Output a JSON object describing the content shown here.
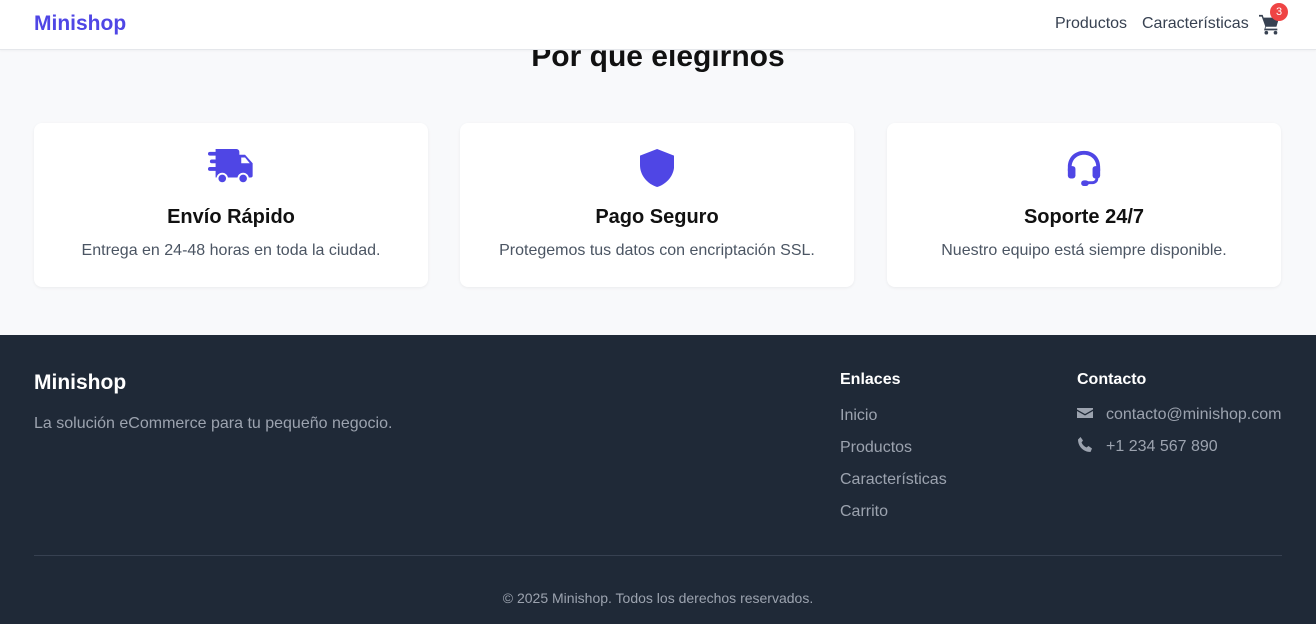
{
  "navbar": {
    "brand": "Minishop",
    "links": [
      "Productos",
      "Características"
    ],
    "cart_count": "3",
    "cart_icon": "shopping-cart-icon"
  },
  "features": {
    "title": "Por qué elegirnos",
    "cards": [
      {
        "icon": "truck-fast-icon",
        "title": "Envío Rápido",
        "description": "Entrega en 24-48 horas en toda la ciudad."
      },
      {
        "icon": "shield-icon",
        "title": "Pago Seguro",
        "description": "Protegemos tus datos con encriptación SSL."
      },
      {
        "icon": "headset-icon",
        "title": "Soporte 24/7",
        "description": "Nuestro equipo está siempre disponible."
      }
    ]
  },
  "footer": {
    "brand": "Minishop",
    "tagline": "La solución eCommerce para tu pequeño negocio.",
    "links_title": "Enlaces",
    "links": [
      "Inicio",
      "Productos",
      "Características",
      "Carrito"
    ],
    "contact_title": "Contacto",
    "contact": [
      {
        "icon": "envelope-icon",
        "text": "contacto@minishop.com"
      },
      {
        "icon": "phone-icon",
        "text": "+1 234 567 890"
      }
    ],
    "copyright": "© 2025 Minishop. Todos los derechos reservados."
  },
  "colors": {
    "brand": "#4f46e5",
    "badge": "#ef4444",
    "footer_bg": "#1f2937",
    "page_bg": "#f8f9fb"
  }
}
